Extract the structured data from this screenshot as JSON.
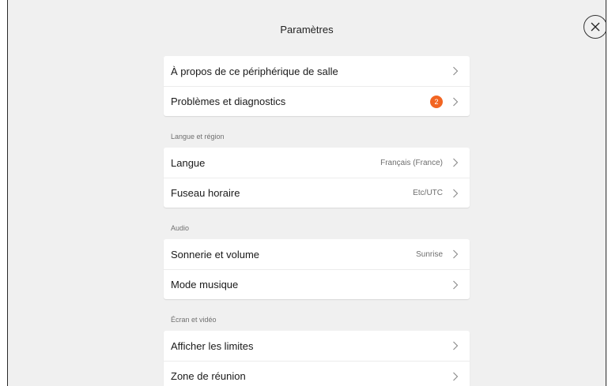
{
  "header": {
    "title": "Paramètres"
  },
  "groups": [
    {
      "items": [
        {
          "label": "À propos de ce périphérique de salle"
        },
        {
          "label": "Problèmes et diagnostics",
          "badge": "2"
        }
      ]
    },
    {
      "section": "Langue et région",
      "items": [
        {
          "label": "Langue",
          "value": "Français (France)"
        },
        {
          "label": "Fuseau horaire",
          "value": "Etc/UTC"
        }
      ]
    },
    {
      "section": "Audio",
      "items": [
        {
          "label": "Sonnerie et volume",
          "value": "Sunrise"
        },
        {
          "label": "Mode musique"
        }
      ]
    },
    {
      "section": "Écran et vidéo",
      "items": [
        {
          "label": "Afficher les limites"
        },
        {
          "label": "Zone de réunion"
        }
      ]
    }
  ],
  "icons": {
    "close": "close-icon",
    "chevron": "chevron-right-icon"
  },
  "colors": {
    "badge": "#f26522",
    "background": "#f0f0f0",
    "card": "#ffffff"
  }
}
